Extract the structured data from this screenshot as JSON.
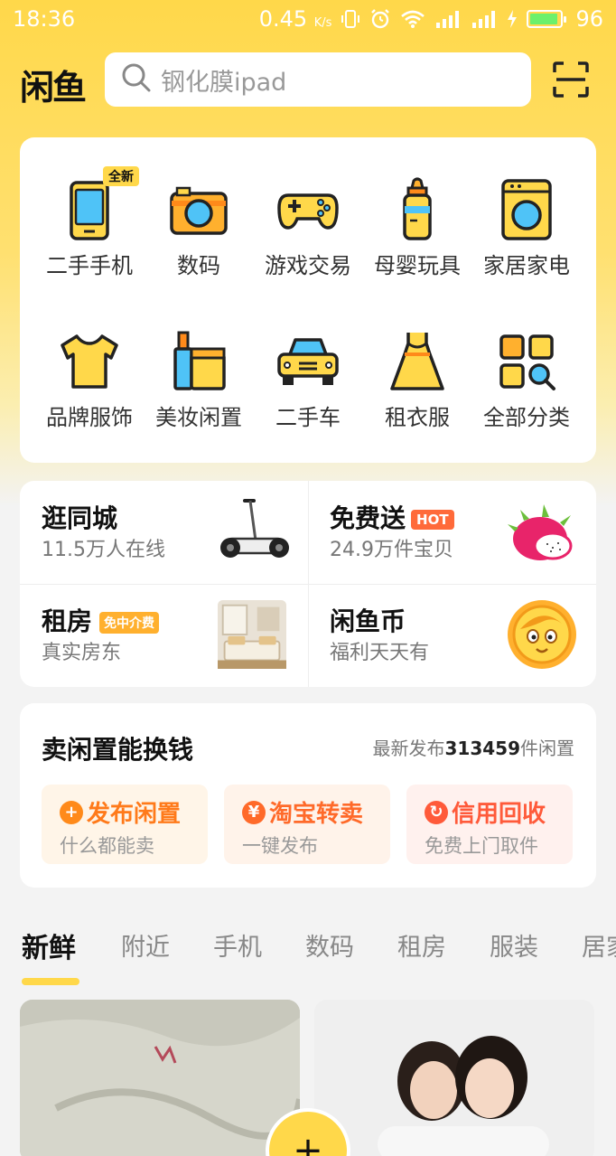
{
  "status_bar": {
    "time": "18:36",
    "net_speed": "0.45",
    "net_unit": "K/s",
    "battery": "96"
  },
  "header": {
    "logo": "闲鱼",
    "search_placeholder": "钢化膜ipad"
  },
  "categories": [
    {
      "label": "二手手机",
      "icon": "phone-icon",
      "badge": "全新"
    },
    {
      "label": "数码",
      "icon": "camera-icon"
    },
    {
      "label": "游戏交易",
      "icon": "gamepad-icon"
    },
    {
      "label": "母婴玩具",
      "icon": "baby-bottle-icon"
    },
    {
      "label": "家居家电",
      "icon": "washing-machine-icon"
    },
    {
      "label": "品牌服饰",
      "icon": "tshirt-icon"
    },
    {
      "label": "美妆闲置",
      "icon": "cosmetics-icon"
    },
    {
      "label": "二手车",
      "icon": "car-icon"
    },
    {
      "label": "租衣服",
      "icon": "dress-icon"
    },
    {
      "label": "全部分类",
      "icon": "all-categories-icon"
    }
  ],
  "services": {
    "city": {
      "title": "逛同城",
      "sub": "11.5万人在线"
    },
    "free": {
      "title": "免费送",
      "tag": "HOT",
      "sub": "24.9万件宝贝"
    },
    "rent": {
      "title": "租房",
      "tag": "免中介费",
      "sub": "真实房东"
    },
    "coin": {
      "title": "闲鱼币",
      "sub": "福利天天有"
    }
  },
  "sell": {
    "title": "卖闲置能换钱",
    "stat_prefix": "最新发布",
    "stat_count": "313459",
    "stat_suffix": "件闲置",
    "buttons": [
      {
        "title": "发布闲置",
        "sub": "什么都能卖",
        "icon_glyph": "+",
        "color": "#ff8a1a"
      },
      {
        "title": "淘宝转卖",
        "sub": "一键发布",
        "icon_glyph": "¥",
        "color": "#ff6a2a"
      },
      {
        "title": "信用回收",
        "sub": "免费上门取件",
        "icon_glyph": "↻",
        "color": "#ff5a3a"
      }
    ]
  },
  "tabs": [
    "新鲜",
    "附近",
    "手机",
    "数码",
    "租房",
    "服装",
    "居家"
  ],
  "fab_glyph": "+",
  "colors": {
    "accent": "#ffd84a",
    "orange": "#ff7a1a"
  }
}
